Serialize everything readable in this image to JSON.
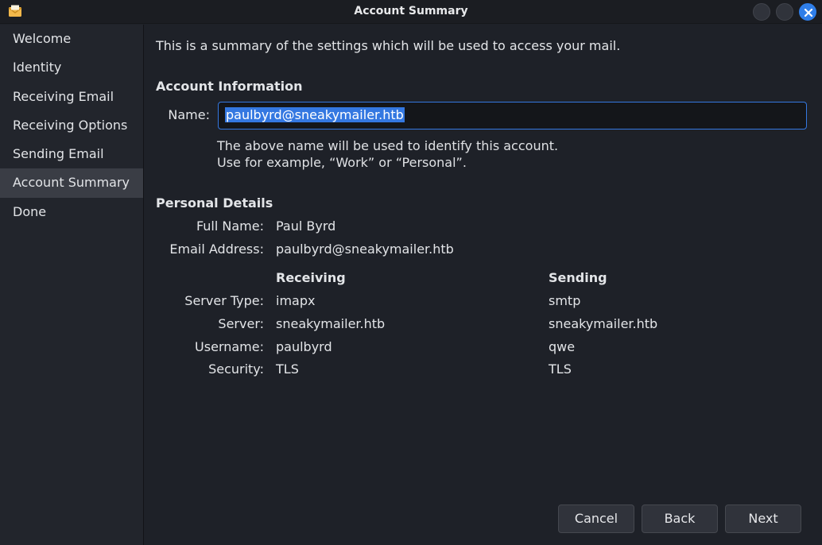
{
  "window": {
    "title": "Account Summary"
  },
  "sidebar": {
    "items": [
      {
        "label": "Welcome"
      },
      {
        "label": "Identity"
      },
      {
        "label": "Receiving Email"
      },
      {
        "label": "Receiving Options"
      },
      {
        "label": "Sending Email"
      },
      {
        "label": "Account Summary"
      },
      {
        "label": "Done"
      }
    ],
    "active": "Account Summary"
  },
  "main": {
    "intro": "This is a summary of the settings which will be used to access your mail.",
    "account_info": {
      "heading": "Account Information",
      "name_label": "Name:",
      "name_value": "paulbyrd@sneakymailer.htb",
      "hint_line1": "The above name will be used to identify this account.",
      "hint_line2": "Use for example, “Work” or “Personal”."
    },
    "personal": {
      "heading": "Personal Details",
      "full_name_label": "Full Name:",
      "full_name": "Paul Byrd",
      "email_label": "Email Address:",
      "email": "paulbyrd@sneakymailer.htb"
    },
    "servers": {
      "receiving_header": "Receiving",
      "sending_header": "Sending",
      "rows": [
        {
          "label": "Server Type:",
          "receiving": "imapx",
          "sending": "smtp"
        },
        {
          "label": "Server:",
          "receiving": "sneakymailer.htb",
          "sending": "sneakymailer.htb"
        },
        {
          "label": "Username:",
          "receiving": "paulbyrd",
          "sending": "qwe"
        },
        {
          "label": "Security:",
          "receiving": "TLS",
          "sending": "TLS"
        }
      ]
    }
  },
  "buttons": {
    "cancel": "Cancel",
    "back": "Back",
    "next": "Next"
  },
  "colors": {
    "accent": "#3478e1",
    "close_button": "#2f7ee9",
    "background": "#1e2128"
  }
}
